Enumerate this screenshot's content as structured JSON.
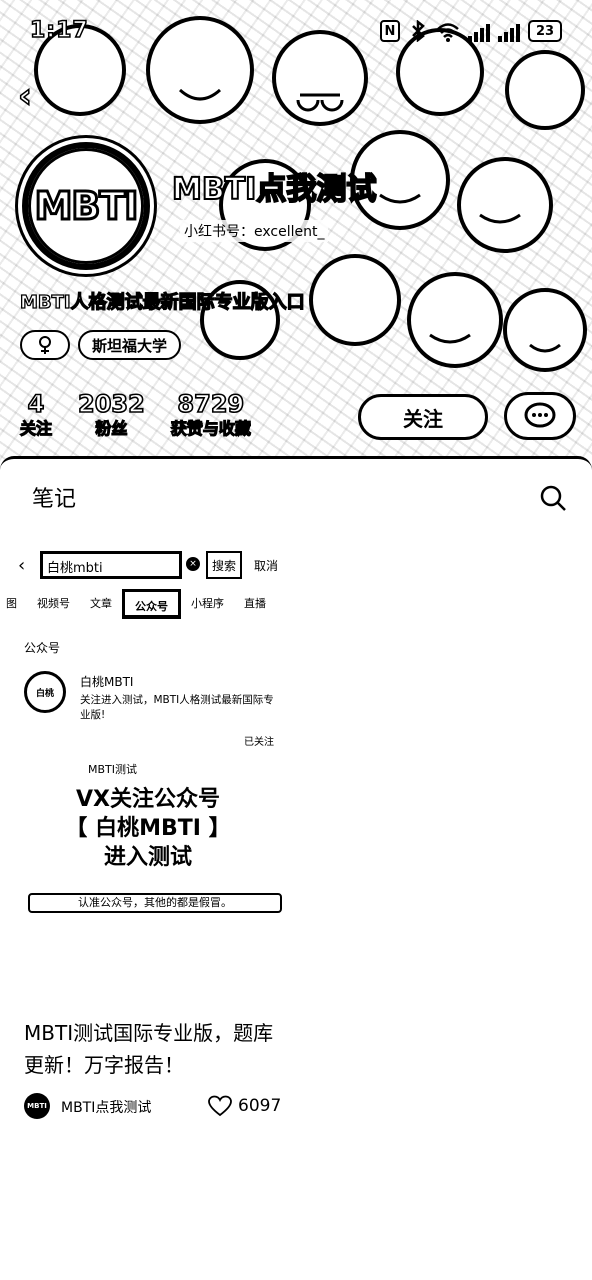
{
  "status_bar": {
    "time": "1:17",
    "battery": "23",
    "nfc": "N"
  },
  "profile": {
    "avatar_text": "MBTI",
    "name": "MBTI点我测试",
    "id_text": "小红书号：excellent_",
    "bio": "MBTI人格测试最新国际专业版入口",
    "tags": [
      "",
      "斯坦福大学"
    ],
    "stats": [
      {
        "value": "4",
        "label": "关注"
      },
      {
        "value": "2032",
        "label": "粉丝"
      },
      {
        "value": "8729",
        "label": "获赞与收藏"
      }
    ],
    "follow_label": "关注"
  },
  "content": {
    "tab_label": "笔记",
    "card": {
      "search_query": "白桃mbti",
      "search_button": "搜索",
      "cancel_label": "取消",
      "tabs": [
        "图",
        "视频号",
        "文章",
        "公众号",
        "小程序",
        "直播"
      ],
      "active_tab": "公众号",
      "section_title": "公众号",
      "account": {
        "avatar_text": "白桃",
        "name": "白桃MBTI",
        "description": "关注进入测试，MBTI人格测试最新国际专业版!",
        "followed": "已关注"
      },
      "article_label": "MBTI测试",
      "headline_lines": [
        "VX关注公众号",
        "【 白桃MBTI 】",
        "进入测试"
      ],
      "notice": "认准公众号，其他的都是假冒。"
    },
    "note": {
      "title": "MBTI测试国际专业版，题库更新！万字报告！",
      "author_avatar": "MBTI",
      "author": "MBTI点我测试",
      "likes": "6097"
    }
  }
}
